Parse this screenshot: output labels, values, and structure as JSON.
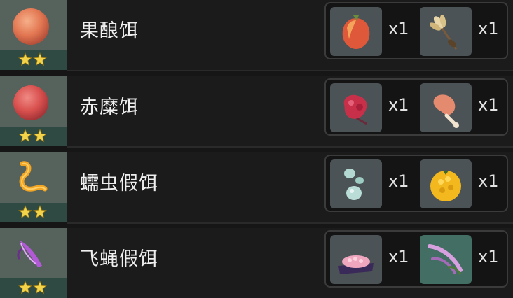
{
  "baits": [
    {
      "name": "果酿饵",
      "rarity": 2,
      "icon": "berry-bait-icon",
      "materials": [
        {
          "icon": "sunsettia-icon",
          "count": "x1"
        },
        {
          "icon": "wheat-icon",
          "count": "x1"
        }
      ]
    },
    {
      "name": "赤糜饵",
      "rarity": 2,
      "icon": "red-bait-icon",
      "materials": [
        {
          "icon": "raw-meat-icon",
          "count": "x1"
        },
        {
          "icon": "fowl-icon",
          "count": "x1"
        }
      ]
    },
    {
      "name": "蠕虫假饵",
      "rarity": 2,
      "icon": "worm-lure-icon",
      "materials": [
        {
          "icon": "slime-condensate-icon",
          "count": "x1"
        },
        {
          "icon": "golden-fruit-icon",
          "count": "x1"
        }
      ]
    },
    {
      "name": "飞蝇假饵",
      "rarity": 2,
      "icon": "fly-lure-icon",
      "materials": [
        {
          "icon": "pink-flower-cluster-icon",
          "count": "x1"
        },
        {
          "icon": "feather-icon",
          "count": "x1"
        }
      ]
    }
  ],
  "colors": {
    "background": "#161616",
    "card_bg": "#56625c",
    "rarity_strip": "#2f4a43",
    "star": "#f3d34a",
    "slot_bg": "#4c5356"
  }
}
